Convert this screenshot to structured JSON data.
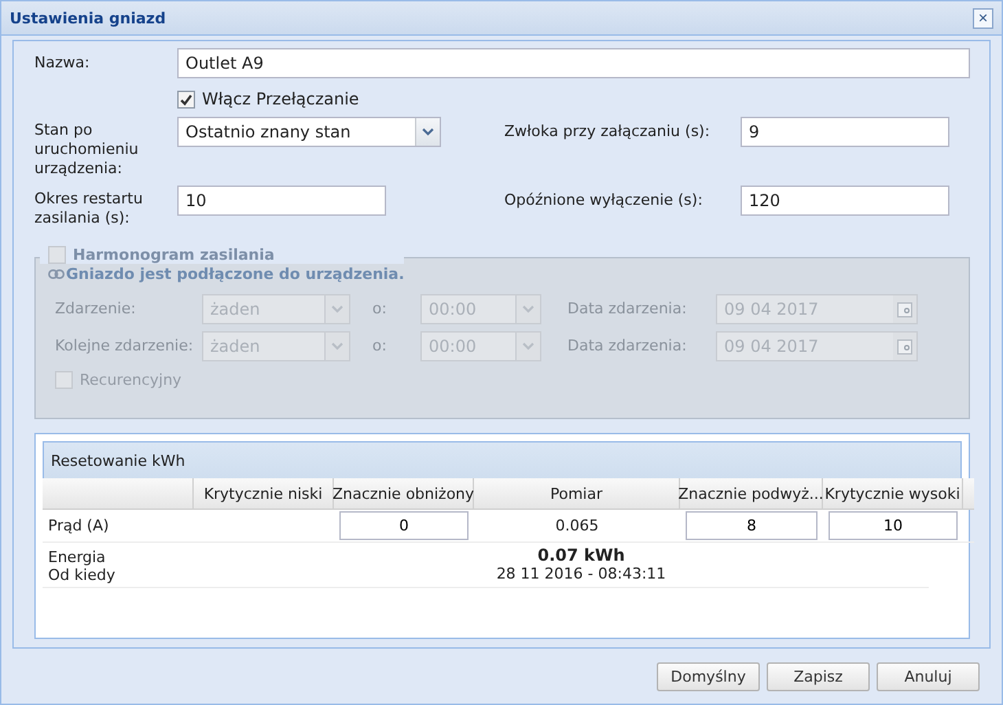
{
  "window": {
    "title": "Ustawienia gniazd",
    "close": "×"
  },
  "form": {
    "name": {
      "label": "Nazwa:",
      "value": "Outlet A9"
    },
    "switching": {
      "label": "Włącz Przełączanie",
      "checked": true
    },
    "startup_state": {
      "label": "Stan po uruchomieniu urządzenia:",
      "value": "Ostatnio znany stan"
    },
    "on_delay": {
      "label": "Zwłoka przy załączaniu (s):",
      "value": "9"
    },
    "restart_period": {
      "label": "Okres restartu zasilania (s):",
      "value": "10"
    },
    "off_delay": {
      "label": "Opóźnione wyłączenie (s):",
      "value": "120"
    }
  },
  "schedule": {
    "label": "Harmonogram zasilania",
    "checked": false,
    "disabled": true,
    "info": "Gniazdo jest podłączone do urządzenia.",
    "rows": [
      {
        "event_label": "Zdarzenie:",
        "event_value": "żaden",
        "at_label": "o:",
        "time_value": "00:00",
        "date_label": "Data zdarzenia:",
        "date_value": "09 04 2017"
      },
      {
        "event_label": "Kolejne zdarzenie:",
        "event_value": "żaden",
        "at_label": "o:",
        "time_value": "00:00",
        "date_label": "Data zdarzenia:",
        "date_value": "09 04 2017"
      }
    ],
    "recurrent": {
      "label": "Recurencyjny",
      "checked": false
    }
  },
  "kwh": {
    "title": "Resetowanie kWh",
    "columns": [
      "Krytycznie niski",
      "Znacznie obniżony",
      "Pomiar",
      "Znacznie podwyż...",
      "Krytycznie wysoki"
    ],
    "current": {
      "label": "Prąd (A)",
      "cells": [
        {
          "kind": "blank"
        },
        {
          "kind": "input",
          "value": "0"
        },
        {
          "kind": "text",
          "value": "0.065"
        },
        {
          "kind": "input",
          "value": "8"
        },
        {
          "kind": "input",
          "value": "10"
        }
      ]
    },
    "energy": {
      "labels": [
        "Energia",
        "Od kiedy"
      ],
      "value": "0.07 kWh",
      "since": "28 11 2016 - 08:43:11"
    }
  },
  "buttons": [
    "Domyślny",
    "Zapisz",
    "Anuluj"
  ]
}
